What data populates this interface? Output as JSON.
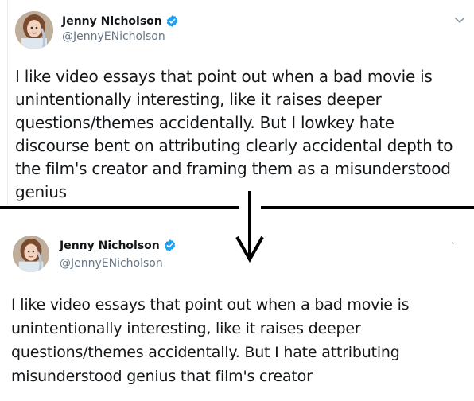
{
  "top_tweet": {
    "display_name": "Jenny Nicholson",
    "handle": "@JennyENicholson",
    "text": "I like video essays that point out when a bad movie is unintentionally interesting, like it raises deeper questions/themes accidentally. But I lowkey hate discourse bent on attributing clearly accidental depth to the film's creator and framing them as a misunderstood genius",
    "menu_icon": "chevron-down-icon",
    "verified_icon": "verified-badge-icon"
  },
  "bottom_tweet": {
    "display_name": "Jenny Nicholson",
    "handle": "@JennyENicholson",
    "text": "I like video essays that point out when a bad movie is unintentionally interesting, like it raises deeper questions/themes accidentally. But I hate attributing misunderstood genius that film's creator",
    "menu_icon": "chevron-down-icon",
    "verified_icon": "verified-badge-icon"
  },
  "colors": {
    "verified_blue": "#1da1f2",
    "handle_gray": "#657786",
    "text": "#14171a",
    "divider": "#000000"
  },
  "arrow_icon": "down-arrow-icon"
}
